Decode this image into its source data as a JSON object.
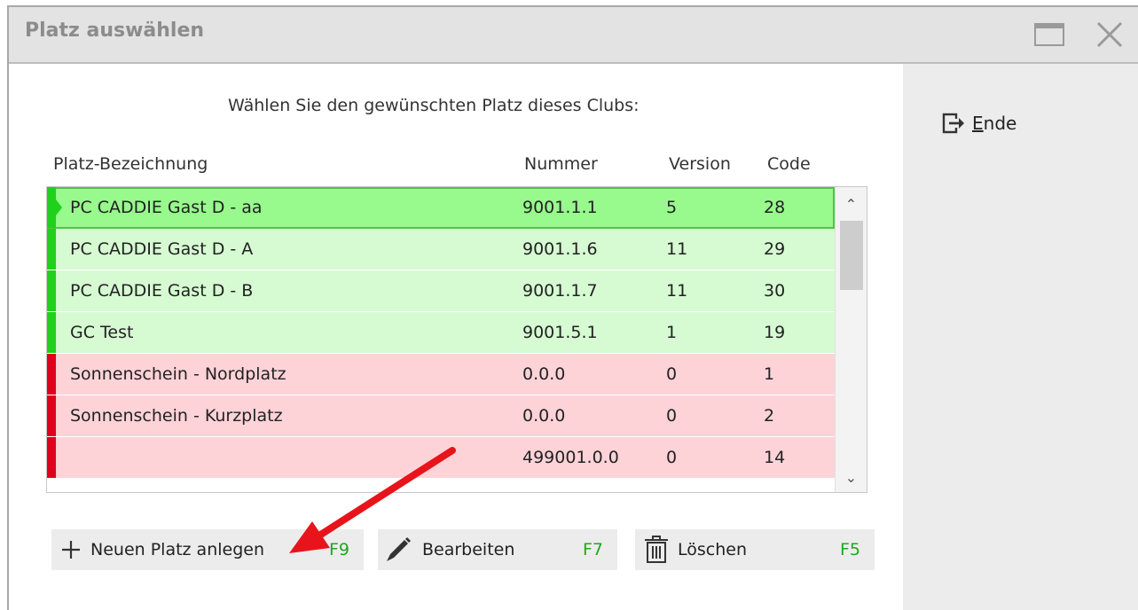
{
  "window": {
    "title": "Platz auswählen"
  },
  "sidebar": {
    "ende_prefix": "E",
    "ende_rest": "nde"
  },
  "prompt": "Wählen Sie den gewünschten Platz dieses Clubs:",
  "columns": {
    "name": "Platz-Bezeichnung",
    "nummer": "Nummer",
    "version": "Version",
    "code": "Code"
  },
  "rows": [
    {
      "name": "PC CADDIE Gast D - aa",
      "nummer": "9001.1.1",
      "version": "5",
      "code": "28",
      "status": "green",
      "selected": true
    },
    {
      "name": "PC CADDIE Gast D - A",
      "nummer": "9001.1.6",
      "version": "11",
      "code": "29",
      "status": "green"
    },
    {
      "name": "PC CADDIE Gast D - B",
      "nummer": "9001.1.7",
      "version": "11",
      "code": "30",
      "status": "green"
    },
    {
      "name": "GC Test",
      "nummer": "9001.5.1",
      "version": "1",
      "code": "19",
      "status": "green"
    },
    {
      "name": "Sonnenschein - Nordplatz",
      "nummer": "0.0.0",
      "version": "0",
      "code": "1",
      "status": "red"
    },
    {
      "name": "Sonnenschein - Kurzplatz",
      "nummer": "0.0.0",
      "version": "0",
      "code": "2",
      "status": "red"
    },
    {
      "name": "",
      "nummer": "499001.0.0",
      "version": "0",
      "code": "14",
      "status": "red"
    }
  ],
  "buttons": {
    "new": {
      "label": "Neuen Platz anlegen",
      "key": "F9",
      "icon": "plus-icon"
    },
    "edit": {
      "label": "Bearbeiten",
      "key": "F7",
      "icon": "pencil-icon"
    },
    "delete": {
      "label": "Löschen",
      "key": "F5",
      "icon": "trash-icon"
    }
  },
  "colors": {
    "row_green": "#d6fbd2",
    "row_selected": "#98f98d",
    "row_red": "#fed3d8",
    "status_green": "#1fd11a",
    "status_red": "#e0001c",
    "shortcut_key": "#1ea81e",
    "annotation_arrow": "#e8141b"
  }
}
